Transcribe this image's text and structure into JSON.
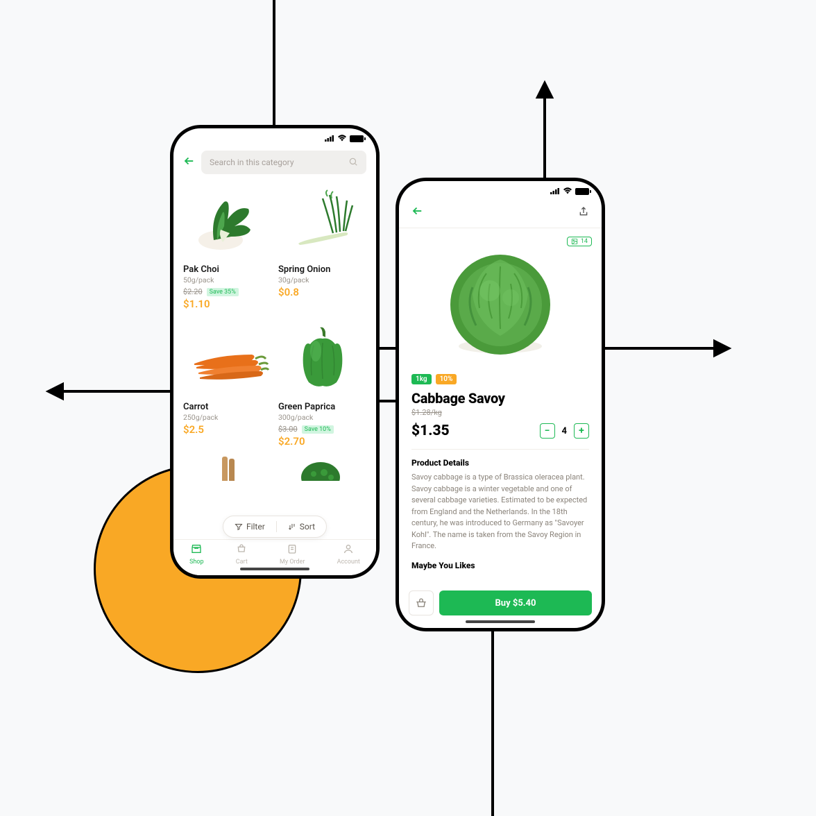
{
  "colors": {
    "accent_green": "#1db954",
    "accent_orange": "#f9a825",
    "muted": "#9a948c"
  },
  "category": {
    "search_placeholder": "Search in this category",
    "products": [
      {
        "name": "Pak Choi",
        "unit": "50g/pack",
        "old_price": "$2.20",
        "discount": "Save 35%",
        "price": "$1.10"
      },
      {
        "name": "Spring Onion",
        "unit": "30g/pack",
        "old_price": "",
        "discount": "",
        "price": "$0.8"
      },
      {
        "name": "Carrot",
        "unit": "250g/pack",
        "old_price": "",
        "discount": "",
        "price": "$2.5"
      },
      {
        "name": "Green Paprica",
        "unit": "300g/pack",
        "old_price": "$3.00",
        "discount": "Save 10%",
        "price": "$2.70"
      }
    ],
    "filter_label": "Filter",
    "sort_label": "Sort",
    "nav": {
      "shop": "Shop",
      "cart": "Cart",
      "order": "My Order",
      "account": "Account"
    }
  },
  "detail": {
    "image_count": "14",
    "weight_badge": "1kg",
    "discount_badge": "10%",
    "title": "Cabbage Savoy",
    "old_price": "$1.28/kg",
    "price": "$1.35",
    "quantity": "4",
    "section_details": "Product Details",
    "description": "Savoy cabbage is a type of Brassica oleracea plant. Savoy cabbage is a winter vegetable and one of several cabbage varieties. Estimated to be expected from England and the Netherlands. In the 18th century, he was introduced to Germany as \"Savoyer Kohl\". The name is taken from the Savoy Region in France.",
    "section_likes": "Maybe You Likes",
    "buy_label": "Buy $5.40"
  }
}
